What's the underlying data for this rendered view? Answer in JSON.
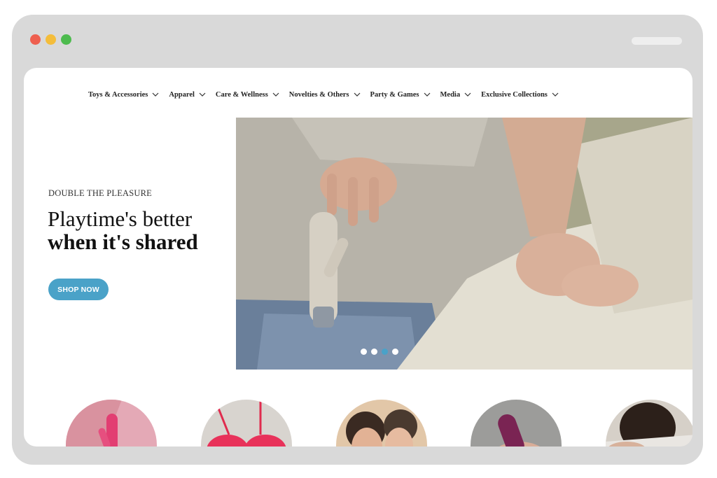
{
  "browser": {
    "traffic_lights": {
      "close": "#ee5f4f",
      "minimize": "#f4bd3b",
      "maximize": "#4dbb4e"
    }
  },
  "nav": {
    "items": [
      {
        "label": "Toys & Accessories"
      },
      {
        "label": "Apparel"
      },
      {
        "label": "Care & Wellness"
      },
      {
        "label": "Novelties & Others"
      },
      {
        "label": "Party & Games"
      },
      {
        "label": "Media"
      },
      {
        "label": "Exclusive Collections"
      }
    ]
  },
  "hero": {
    "eyebrow": "DOUBLE THE PLEASURE",
    "headline_line1": "Playtime's better",
    "headline_line2": "when it's shared",
    "cta_label": "SHOP NOW",
    "slide_count": 4,
    "active_slide": 3
  },
  "colors": {
    "accent": "#4aa2c8",
    "text": "#111111",
    "frame": "#d9d9d9"
  },
  "categories": [
    {
      "image": "pink-vibrator"
    },
    {
      "image": "red-lace-bra"
    },
    {
      "image": "couple-portrait"
    },
    {
      "image": "purple-toy-in-hand"
    },
    {
      "image": "couple-embrace"
    }
  ]
}
